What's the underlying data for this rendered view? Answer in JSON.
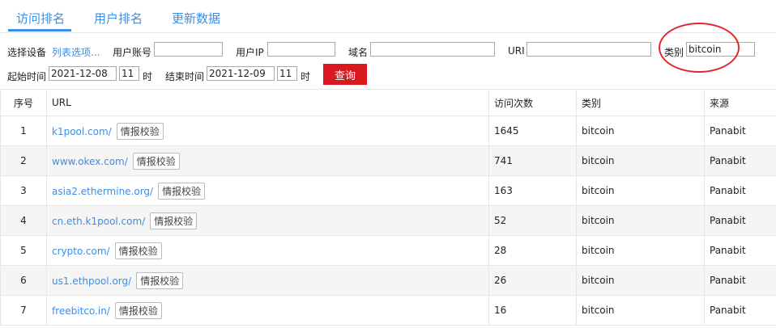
{
  "tabs": [
    {
      "label": "访问排名"
    },
    {
      "label": "用户排名"
    },
    {
      "label": "更新数据"
    }
  ],
  "filters": {
    "device_label": "选择设备",
    "device_link": "列表选项...",
    "account_label": "用户账号",
    "account_value": "",
    "ip_label": "用户IP",
    "ip_value": "",
    "domain_label": "域名",
    "domain_value": "",
    "uri_label": "URI",
    "uri_value": "",
    "category_label": "类别",
    "category_value": "bitcoin",
    "start_label": "起始时间",
    "start_date": "2021-12-08",
    "start_hour": "11",
    "end_label": "结束时间",
    "end_date": "2021-12-09",
    "end_hour": "11",
    "hour_unit": "时",
    "query_label": "查询"
  },
  "table": {
    "headers": [
      "序号",
      "URL",
      "访问次数",
      "类别",
      "来源"
    ],
    "verify_label": "情报校验",
    "rows": [
      {
        "no": "1",
        "url": "k1pool.com/",
        "count": "1645",
        "category": "bitcoin",
        "source": "Panabit"
      },
      {
        "no": "2",
        "url": "www.okex.com/",
        "count": "741",
        "category": "bitcoin",
        "source": "Panabit"
      },
      {
        "no": "3",
        "url": "asia2.ethermine.org/",
        "count": "163",
        "category": "bitcoin",
        "source": "Panabit"
      },
      {
        "no": "4",
        "url": "cn.eth.k1pool.com/",
        "count": "52",
        "category": "bitcoin",
        "source": "Panabit"
      },
      {
        "no": "5",
        "url": "crypto.com/",
        "count": "28",
        "category": "bitcoin",
        "source": "Panabit"
      },
      {
        "no": "6",
        "url": "us1.ethpool.org/",
        "count": "26",
        "category": "bitcoin",
        "source": "Panabit"
      },
      {
        "no": "7",
        "url": "freebitco.in/",
        "count": "16",
        "category": "bitcoin",
        "source": "Panabit"
      }
    ]
  },
  "colors": {
    "accent": "#3a8ee6",
    "query_button": "#d9181f",
    "highlight_circle": "#e4262c"
  }
}
